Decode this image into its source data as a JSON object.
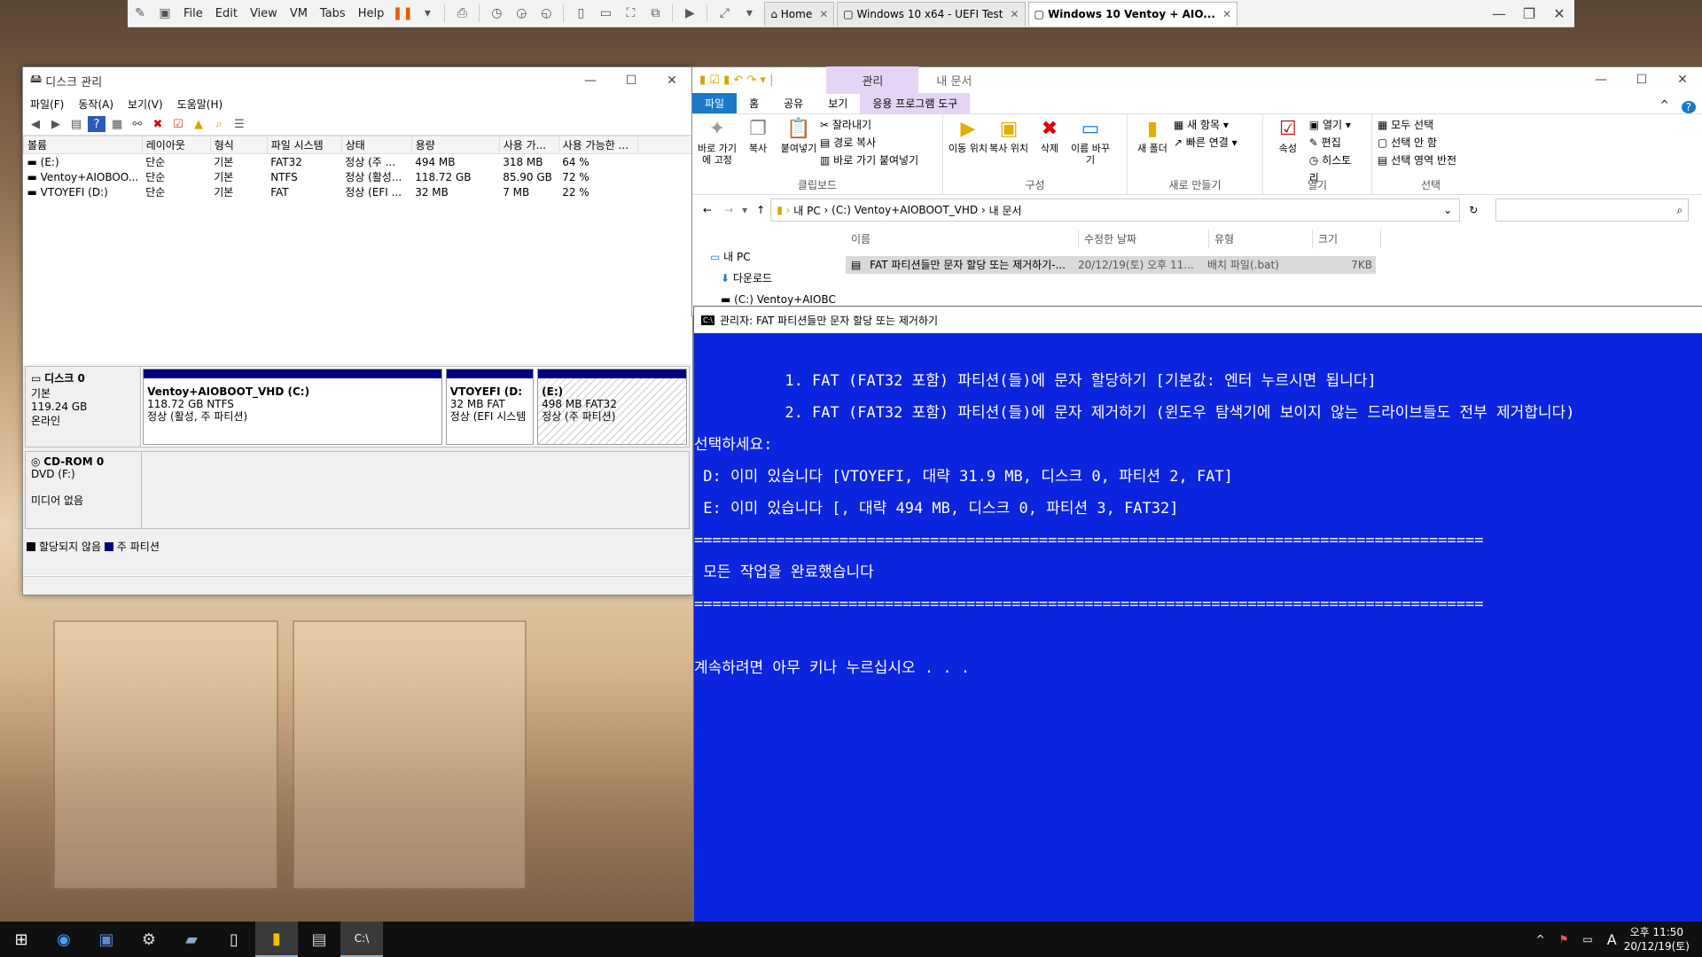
{
  "vm": {
    "menus": [
      "File",
      "Edit",
      "View",
      "VM",
      "Tabs",
      "Help"
    ],
    "tabs": [
      {
        "label": "Home",
        "active": false
      },
      {
        "label": "Windows 10 x64 - UEFI Test",
        "active": false
      },
      {
        "label": "Windows 10 Ventoy + AIO...",
        "active": true
      }
    ]
  },
  "diskmgmt": {
    "title": "디스크 관리",
    "menu": [
      "파일(F)",
      "동작(A)",
      "보기(V)",
      "도움말(H)"
    ],
    "columns": [
      "볼륨",
      "레이아웃",
      "형식",
      "파일 시스템",
      "상태",
      "용량",
      "사용 가...",
      "사용 가능한 ..."
    ],
    "volumes": [
      [
        "(E:)",
        "단순",
        "기본",
        "FAT32",
        "정상 (주 ...",
        "494 MB",
        "318 MB",
        "64 %"
      ],
      [
        "Ventoy+AIOBOO...",
        "단순",
        "기본",
        "NTFS",
        "정상 (활성...",
        "118.72 GB",
        "85.90 GB",
        "72 %"
      ],
      [
        "VTOYEFI (D:)",
        "단순",
        "기본",
        "FAT",
        "정상 (EFI ...",
        "32 MB",
        "7 MB",
        "22 %"
      ]
    ],
    "disk0": {
      "name": "디스크 0",
      "type": "기본",
      "size": "119.24 GB",
      "status": "온라인",
      "partitions": [
        {
          "name": "Ventoy+AIOBOOT_VHD  (C:)",
          "size": "118.72 GB NTFS",
          "status": "정상 (활성, 주 파티션)"
        },
        {
          "name": "VTOYEFI  (D:",
          "size": "32 MB FAT",
          "status": "정상 (EFI 시스템"
        },
        {
          "name": "(E:)",
          "size": "498 MB FAT32",
          "status": "정상 (주 파티션)"
        }
      ]
    },
    "cdrom": {
      "name": "CD-ROM 0",
      "type": "DVD (F:)",
      "status": "미디어 없음"
    },
    "legend": {
      "unallocated": "할당되지 않음",
      "primary": "주 파티션"
    }
  },
  "explorer": {
    "title": "내 문서",
    "tabs": [
      "파일",
      "홈",
      "공유",
      "보기"
    ],
    "context_tab_group": "관리",
    "context_tab": "응용 프로그램 도구",
    "ribbon": {
      "clipboard": {
        "label": "클립보드",
        "pin": "바로 가기에 고정",
        "copy": "복사",
        "paste": "붙여넣기",
        "cut": "잘라내기",
        "copy_path": "경로 복사",
        "paste_shortcut": "바로 가기 붙여넣기"
      },
      "organize": {
        "label": "구성",
        "move": "이동 위치",
        "copy_to": "복사 위치",
        "delete": "삭제",
        "rename": "이름 바꾸기"
      },
      "new": {
        "label": "새로 만들기",
        "folder": "새 폴더",
        "new_item": "새 항목",
        "easy_access": "빠른 연결"
      },
      "open": {
        "label": "열기",
        "properties": "속성",
        "open": "열기",
        "edit": "편집",
        "history": "히스토리"
      },
      "select": {
        "label": "선택",
        "all": "모두 선택",
        "none": "선택 안 함",
        "invert": "선택 영역 반전"
      }
    },
    "breadcrumb": [
      "내 PC",
      "(C:) Ventoy+AIOBOOT_VHD",
      "내 문서"
    ],
    "nav": [
      "내 PC",
      "다운로드",
      "(C:) Ventoy+AIOBC"
    ],
    "columns": [
      "이름",
      "수정한 날짜",
      "유형",
      "크기"
    ],
    "file": {
      "name": "FAT 파티션들만 문자 할당 또는 제거하기-...",
      "date": "20/12/19(토) 오후 11...",
      "type": "배치 파일(.bat)",
      "size": "7KB"
    }
  },
  "cmd": {
    "title": "관리자:  FAT 파티션들만 문자 할당 또는 제거하기",
    "lines": [
      "",
      "          1. FAT (FAT32 포함) 파티션(들)에 문자 할당하기 [기본값: 엔터 누르시면 됩니다]",
      "          2. FAT (FAT32 포함) 파티션(들)에 문자 제거하기 (윈도우 탐색기에 보이지 않는 드라이브들도 전부 제거합니다)",
      "선택하세요:",
      " D: 이미 있습니다 [VTOYEFI, 대략 31.9 MB, 디스크 0, 파티션 2, FAT]",
      " E: 이미 있습니다 [, 대략 494 MB, 디스크 0, 파티션 3, FAT32]",
      "=======================================================================================",
      " 모든 작업을 완료했습니다",
      "=======================================================================================",
      "",
      "계속하려면 아무 키나 누르십시오 . . ."
    ]
  },
  "taskbar": {
    "time": "오후 11:50",
    "date": "20/12/19(토)",
    "ime": "A"
  }
}
